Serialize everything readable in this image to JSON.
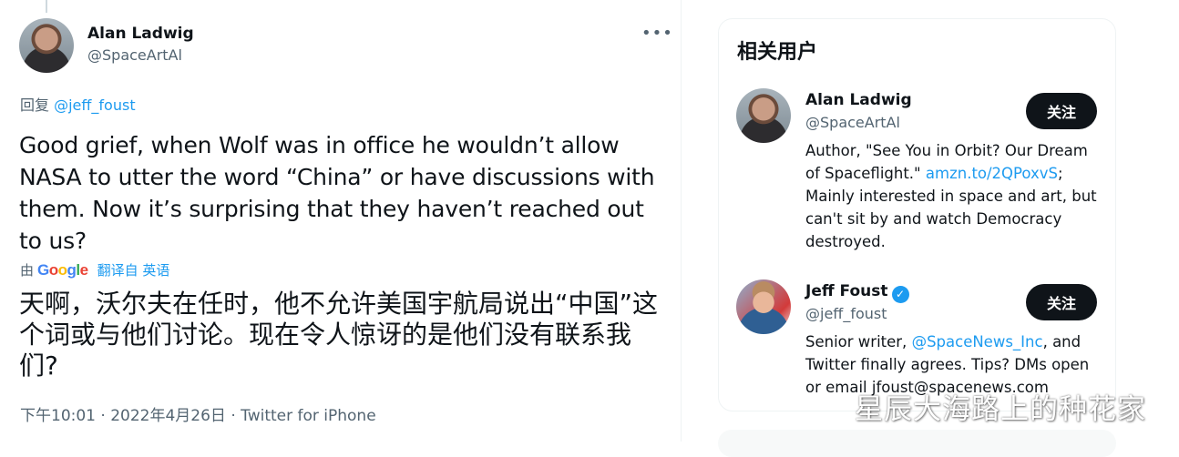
{
  "tweet": {
    "author_name": "Alan Ladwig",
    "author_handle": "@SpaceArtAl",
    "more_label": "•••",
    "reply_prefix": "回复",
    "reply_handle": "@jeff_foust",
    "text": "Good grief, when Wolf was in office he wouldn’t allow NASA to utter the word “China” or have discussions with them. Now it’s surprising that they haven’t reached out to us?",
    "translated_by_prefix": "由",
    "translate_link": "翻译自 英语",
    "translated_text": "天啊，沃尔夫在任时，他不允许美国宇航局说出“中国”这个词或与他们讨论。现在令人惊讶的是他们没有联系我们?",
    "meta": "下午10:01 · 2022年4月26日 · Twitter for iPhone"
  },
  "google_logo": "Google",
  "related_users": {
    "title": "相关用户",
    "users": [
      {
        "name": "Alan Ladwig",
        "handle": "@SpaceArtAl",
        "follow_label": "关注",
        "bio_part1": "Author, \"See You in Orbit? Our Dream of Spaceflight.\" ",
        "bio_link": "amzn.to/2QPoxvS",
        "bio_part2": "; Mainly interested in space and art, but can't sit by and watch Democracy destroyed."
      },
      {
        "name": "Jeff Foust",
        "handle": "@jeff_foust",
        "verified": true,
        "follow_label": "关注",
        "bio_part1": "Senior writer, ",
        "bio_link": "@SpaceNews_Inc",
        "bio_part2": ", and Twitter finally agrees. Tips? DMs open or email jfoust@spacenews.com"
      }
    ]
  },
  "watermark": "星辰大海路上的种花家",
  "colors": {
    "link": "#1d9bf0",
    "follow_button": "#0f1419",
    "secondary_text": "#536471"
  }
}
